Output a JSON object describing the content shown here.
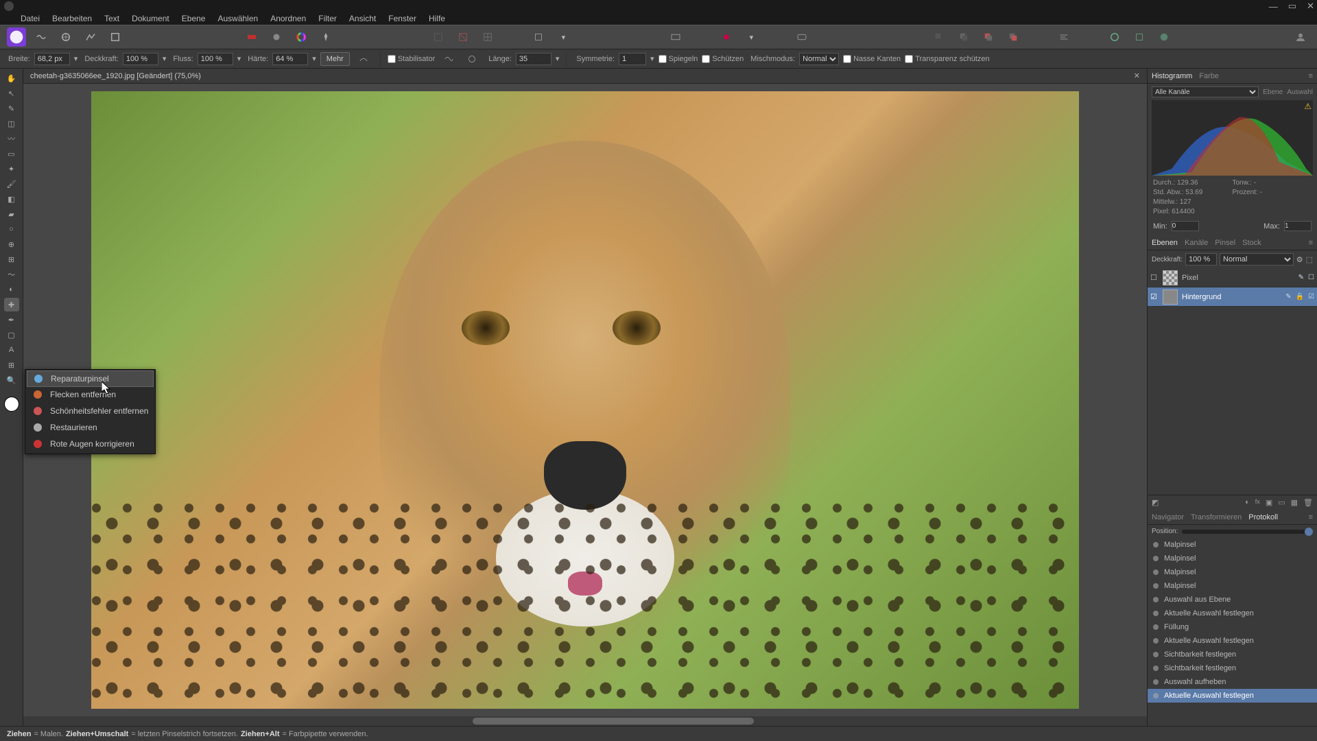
{
  "menu": [
    "Datei",
    "Bearbeiten",
    "Text",
    "Dokument",
    "Ebene",
    "Auswählen",
    "Anordnen",
    "Filter",
    "Ansicht",
    "Fenster",
    "Hilfe"
  ],
  "document": {
    "title": "cheetah-g3635066ee_1920.jpg [Geändert] (75,0%)"
  },
  "context": {
    "breite_label": "Breite:",
    "breite": "68,2 px",
    "deckkraft_label": "Deckkraft:",
    "deckkraft": "100 %",
    "fluss_label": "Fluss:",
    "fluss": "100 %",
    "haerte_label": "Härte:",
    "haerte": "64 %",
    "mehr": "Mehr",
    "stabilisator": "Stabilisator",
    "laenge_label": "Länge:",
    "laenge": "35",
    "symmetrie_label": "Symmetrie:",
    "symmetrie": "1",
    "spiegeln": "Spiegeln",
    "schuetzen": "Schützen",
    "misch_label": "Mischmodus:",
    "misch": "Normal",
    "nasse": "Nasse Kanten",
    "transparenz": "Transparenz schützen"
  },
  "flyout": [
    {
      "icon": "heal",
      "label": "Reparaturpinsel",
      "hover": true
    },
    {
      "icon": "patch",
      "label": "Flecken entfernen"
    },
    {
      "icon": "blemish",
      "label": "Schönheitsfehler entfernen"
    },
    {
      "icon": "inpaint",
      "label": "Restaurieren"
    },
    {
      "icon": "redeye",
      "label": "Rote Augen korrigieren"
    }
  ],
  "histogram": {
    "tabs": [
      "Histogramm",
      "Farbe"
    ],
    "channel": "Alle Kanäle",
    "scope": [
      "Ebene",
      "Auswahl"
    ],
    "stats": {
      "durch": "Durch.: 129.36",
      "std": "Std. Abw.: 53.69",
      "mittelw": "Mittelw.: 127",
      "pixel": "Pixel: 614400",
      "tonw": "Tonw.: -",
      "prozent": "Prozent: -"
    },
    "min_label": "Min:",
    "min": "0",
    "max_label": "Max:",
    "max": "1"
  },
  "layers": {
    "tabs": [
      "Ebenen",
      "Kanäle",
      "Pinsel",
      "Stock"
    ],
    "opacity_label": "Deckkraft:",
    "opacity": "100 %",
    "blend": "Normal",
    "items": [
      {
        "name": "Pixel",
        "selected": false,
        "checker": true
      },
      {
        "name": "Hintergrund",
        "selected": true,
        "checker": false
      }
    ]
  },
  "protocol": {
    "tabs": [
      "Navigator",
      "Transformieren",
      "Protokoll"
    ],
    "position_label": "Position:",
    "items": [
      "Malpinsel",
      "Malpinsel",
      "Malpinsel",
      "Malpinsel",
      "Auswahl aus Ebene",
      "Aktuelle Auswahl festlegen",
      "Füllung",
      "Aktuelle Auswahl festlegen",
      "Sichtbarkeit festlegen",
      "Sichtbarkeit festlegen",
      "Auswahl aufheben",
      "Aktuelle Auswahl festlegen"
    ],
    "selected_index": 11
  },
  "status": {
    "k1": "Ziehen",
    "v1": " = Malen. ",
    "k2": "Ziehen+Umschalt",
    "v2": " = letzten Pinselstrich fortsetzen. ",
    "k3": "Ziehen+Alt",
    "v3": " = Farbpipette verwenden."
  }
}
